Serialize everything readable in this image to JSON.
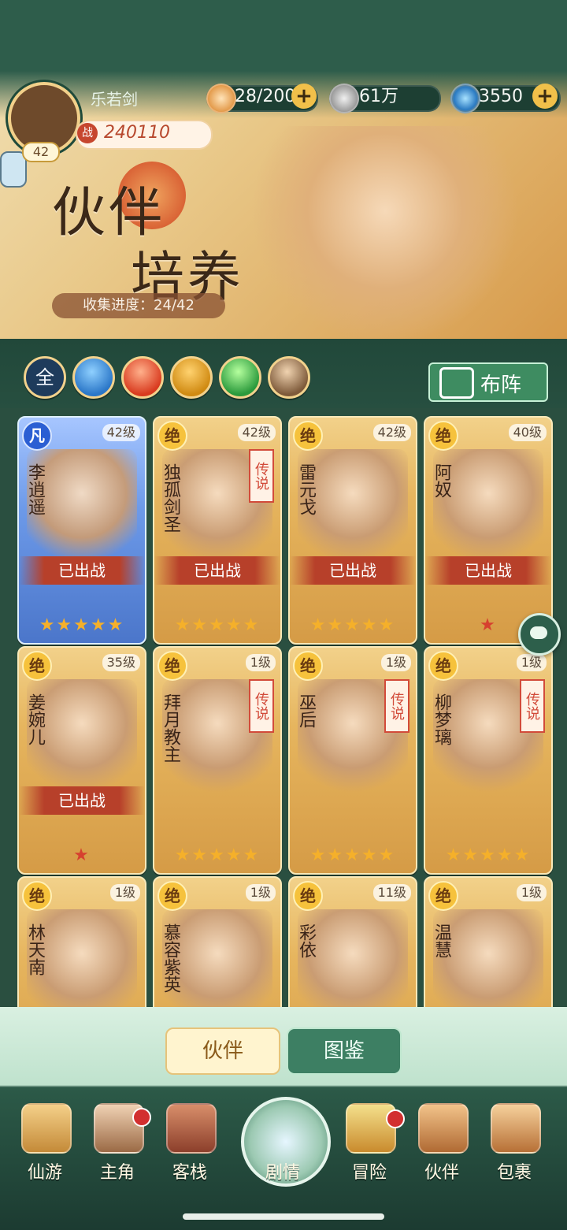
{
  "player": {
    "name": "乐若剑",
    "level": "42",
    "power_icon": "战",
    "power": "240110"
  },
  "resources": [
    {
      "icon": "steamed-bun-icon",
      "value": "28/200"
    },
    {
      "icon": "coin-icon",
      "value": "61万"
    },
    {
      "icon": "jade-currency-icon",
      "value": "3550"
    }
  ],
  "banner": {
    "title_line1": "伙伴",
    "title_line2": "培养",
    "collection_text": "收集进度：24/42"
  },
  "filters": [
    {
      "label": "全",
      "icon": "all-icon"
    },
    {
      "icon": "water-icon"
    },
    {
      "icon": "fire-icon"
    },
    {
      "icon": "thunder-icon"
    },
    {
      "icon": "wind-icon"
    },
    {
      "icon": "earth-icon"
    }
  ],
  "formation_button_label": "布阵",
  "companions": [
    {
      "name": "李逍遥",
      "level": "42级",
      "rank": "凡",
      "legend": "",
      "deployed": "已出战",
      "stars": "★★★★★"
    },
    {
      "name": "独孤剑圣",
      "level": "42级",
      "rank": "绝",
      "legend": "传说",
      "deployed": "已出战",
      "stars": "★★★★★"
    },
    {
      "name": "雷元戈",
      "level": "42级",
      "rank": "绝",
      "legend": "",
      "deployed": "已出战",
      "stars": "★★★★★"
    },
    {
      "name": "阿奴",
      "level": "40级",
      "rank": "绝",
      "legend": "",
      "deployed": "已出战",
      "stars": "★"
    },
    {
      "name": "姜婉儿",
      "level": "35级",
      "rank": "绝",
      "legend": "",
      "deployed": "已出战",
      "stars": "★"
    },
    {
      "name": "拜月教主",
      "level": "1级",
      "rank": "绝",
      "legend": "传说",
      "deployed": "",
      "stars": "★★★★★"
    },
    {
      "name": "巫后",
      "level": "1级",
      "rank": "绝",
      "legend": "传说",
      "deployed": "",
      "stars": "★★★★★"
    },
    {
      "name": "柳梦璃",
      "level": "1级",
      "rank": "绝",
      "legend": "传说",
      "deployed": "",
      "stars": "★★★★★"
    },
    {
      "name": "林天南",
      "level": "1级",
      "rank": "绝",
      "legend": "",
      "deployed": "",
      "stars": ""
    },
    {
      "name": "慕容紫英",
      "level": "1级",
      "rank": "绝",
      "legend": "",
      "deployed": "",
      "stars": ""
    },
    {
      "name": "彩依",
      "level": "11级",
      "rank": "绝",
      "legend": "",
      "deployed": "",
      "stars": ""
    },
    {
      "name": "温慧",
      "level": "1级",
      "rank": "绝",
      "legend": "",
      "deployed": "",
      "stars": ""
    }
  ],
  "tabs": {
    "companions": "伙伴",
    "catalog": "图鉴"
  },
  "bottom_nav": [
    {
      "label": "仙游",
      "icon": "scroll-icon"
    },
    {
      "label": "主角",
      "icon": "hero-icon"
    },
    {
      "label": "客栈",
      "icon": "inn-icon"
    },
    {
      "label": "剧情",
      "icon": "story-icon"
    },
    {
      "label": "冒险",
      "icon": "gourd-icon"
    },
    {
      "label": "伙伴",
      "icon": "cards-icon"
    },
    {
      "label": "包裹",
      "icon": "bag-icon"
    }
  ],
  "colors": {
    "accent_green": "#3e8c61",
    "gold": "#f2d28d",
    "deployed_red": "#b7402a"
  }
}
